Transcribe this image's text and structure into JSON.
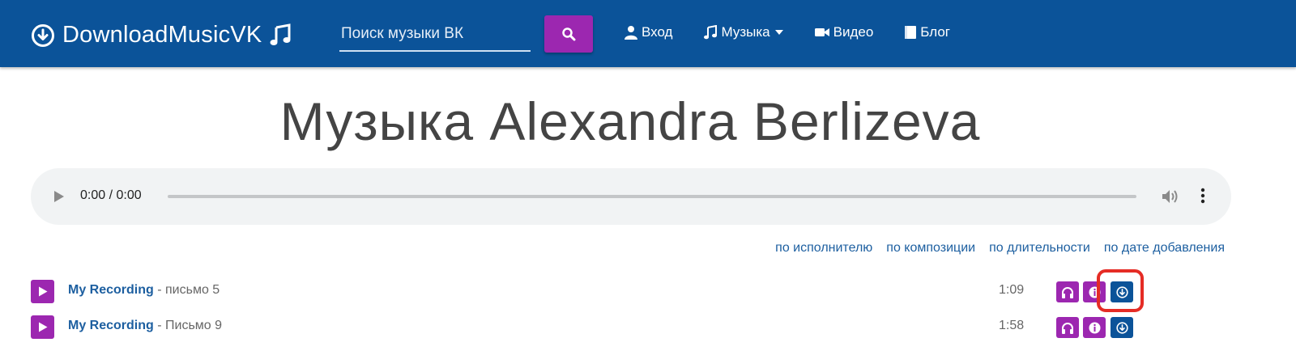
{
  "nav": {
    "brand": "DownloadMusicVK",
    "brand_icons": [
      "download-circle-icon",
      "music-note-icon"
    ],
    "search": {
      "placeholder": "Поиск музыки ВК",
      "value": ""
    },
    "search_button_icon": "search-icon",
    "links": [
      {
        "label": "Вход",
        "icon": "user-icon"
      },
      {
        "label": "Музыка",
        "icon": "music-note-icon",
        "dropdown": true
      },
      {
        "label": "Видео",
        "icon": "video-camera-icon"
      },
      {
        "label": "Блог",
        "icon": "book-icon"
      }
    ]
  },
  "page": {
    "title": "Музыка Alexandra Berlizeva"
  },
  "player": {
    "time": "0:00 / 0:00",
    "progress": 0
  },
  "sort": {
    "by_artist": "по исполнителю",
    "by_title": "по композиции",
    "by_duration": "по длительности",
    "by_date": "по дате добавления"
  },
  "tracks": [
    {
      "artist": "My Recording",
      "separator": " - ",
      "title": "письмо 5",
      "duration": "1:09"
    },
    {
      "artist": "My Recording",
      "separator": " - ",
      "title": "Письмо 9",
      "duration": "1:58"
    }
  ],
  "colors": {
    "navbar": "#0b5399",
    "accent_purple": "#9c27b0",
    "link_blue": "#1d5fa0",
    "highlight_red": "#e52c25",
    "player_bg": "#f1f3f4"
  }
}
